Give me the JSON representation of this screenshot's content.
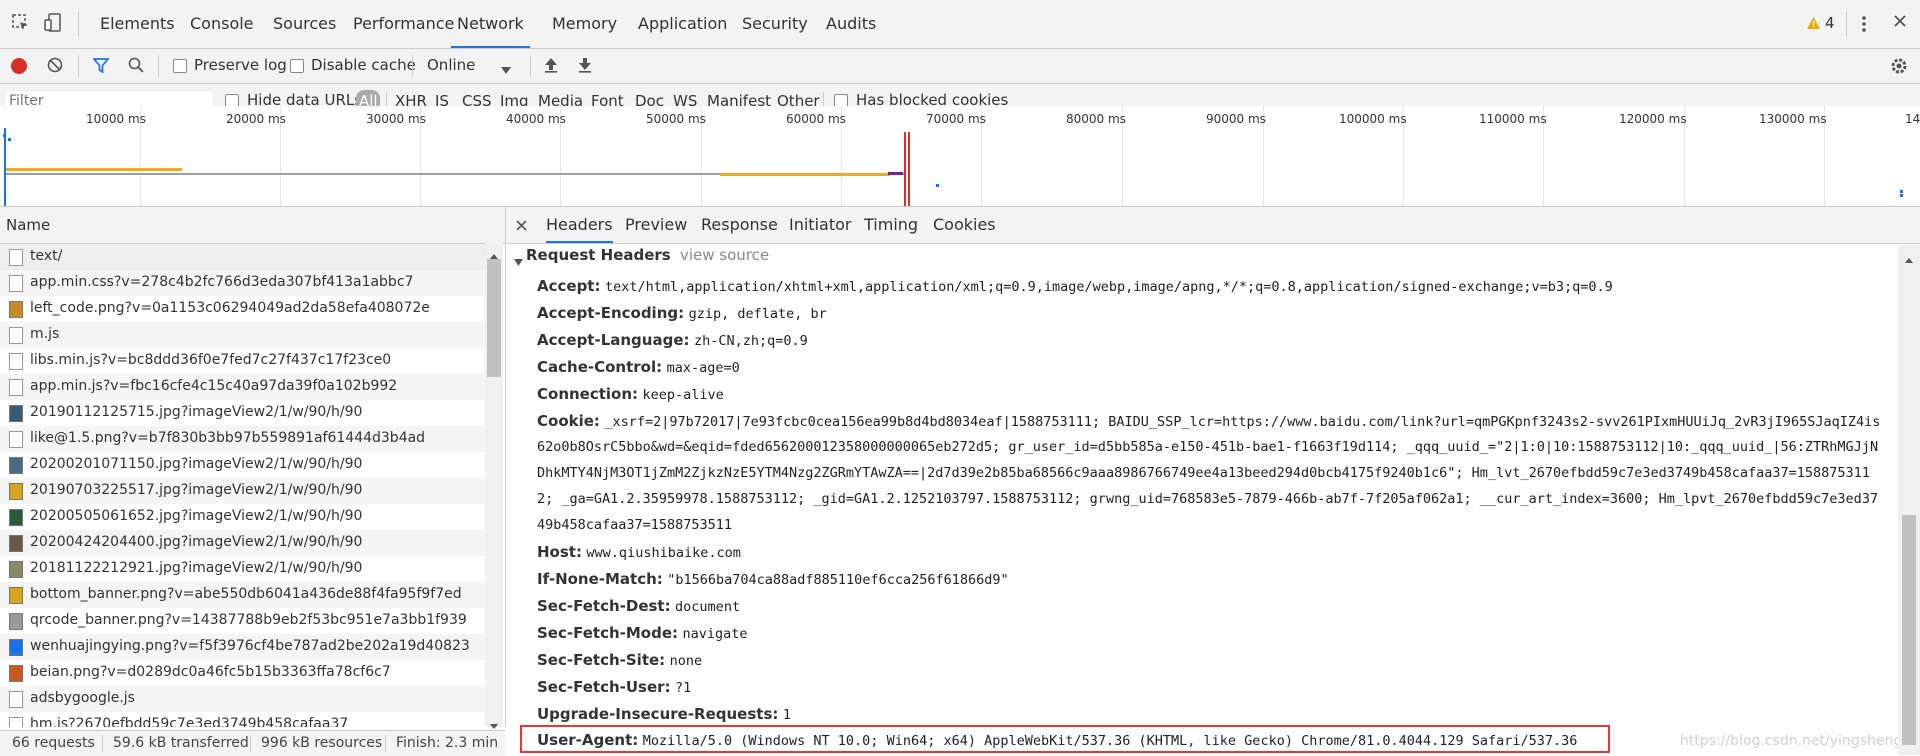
{
  "topbar": {
    "tabs": [
      "Elements",
      "Console",
      "Sources",
      "Performance",
      "Network",
      "Memory",
      "Application",
      "Security",
      "Audits"
    ],
    "active_tab": "Network",
    "warning_count": "4"
  },
  "toolbar": {
    "preserve_log": "Preserve log",
    "disable_cache": "Disable cache",
    "throttle": "Online"
  },
  "filterbar": {
    "placeholder": "Filter",
    "hide_data_urls": "Hide data URLs",
    "types": [
      "All",
      "XHR",
      "JS",
      "CSS",
      "Img",
      "Media",
      "Font",
      "Doc",
      "WS",
      "Manifest",
      "Other"
    ],
    "has_blocked_cookies": "Has blocked cookies"
  },
  "overview": {
    "ticks": [
      "10000 ms",
      "20000 ms",
      "30000 ms",
      "40000 ms",
      "50000 ms",
      "60000 ms",
      "70000 ms",
      "80000 ms",
      "90000 ms",
      "100000 ms",
      "110000 ms",
      "120000 ms",
      "130000 ms",
      "14"
    ]
  },
  "requests": {
    "header": "Name",
    "items": [
      "text/",
      "app.min.css?v=278c4b2fc766d3eda307bf413a1abbc7",
      "left_code.png?v=0a1153c06294049ad2da58efa408072e",
      "m.js",
      "libs.min.js?v=bc8ddd36f0e7fed7c27f437c17f23ce0",
      "app.min.js?v=fbc16cfe4c15c40a97da39f0a102b992",
      "20190112125715.jpg?imageView2/1/w/90/h/90",
      "like@1.5.png?v=b7f830b3bb97b559891af61444d3b4ad",
      "20200201071150.jpg?imageView2/1/w/90/h/90",
      "20190703225517.jpg?imageView2/1/w/90/h/90",
      "20200505061652.jpg?imageView2/1/w/90/h/90",
      "20200424204400.jpg?imageView2/1/w/90/h/90",
      "20181122212921.jpg?imageView2/1/w/90/h/90",
      "bottom_banner.png?v=abe550db6041a436de88f4fa95f9f7ed",
      "qrcode_banner.png?v=14387788b9eb2f53bc951e7a3bb1f939",
      "wenhuajingying.png?v=f5f3976cf4be787ad2be202a19d40823",
      "beian.png?v=d0289dc0a46fc5b15b3363ffa78cf6c7",
      "adsbygoogle.js",
      "hm.js?2670efbdd59c7e3ed3749b458cafaa37"
    ]
  },
  "status": {
    "requests": "66 requests",
    "transferred": "59.6 kB transferred",
    "resources": "996 kB resources",
    "finish": "Finish: 2.3 min"
  },
  "details": {
    "tabs": [
      "Headers",
      "Preview",
      "Response",
      "Initiator",
      "Timing",
      "Cookies"
    ],
    "active_tab": "Headers",
    "section_title": "Request Headers",
    "view_source": "view source",
    "headers": [
      {
        "key": "Accept:",
        "value": "text/html,application/xhtml+xml,application/xml;q=0.9,image/webp,image/apng,*/*;q=0.8,application/signed-exchange;v=b3;q=0.9"
      },
      {
        "key": "Accept-Encoding:",
        "value": "gzip, deflate, br"
      },
      {
        "key": "Accept-Language:",
        "value": "zh-CN,zh;q=0.9"
      },
      {
        "key": "Cache-Control:",
        "value": "max-age=0"
      },
      {
        "key": "Connection:",
        "value": "keep-alive"
      }
    ],
    "cookie_key": "Cookie:",
    "cookie_lines": [
      "_xsrf=2|97b72017|7e93fcbc0cea156ea99b8d4bd8034eaf|1588753111; BAIDU_SSP_lcr=https://www.baidu.com/link?url=qmPGKpnf3243s2-svv261PIxmHUUiJq_2vR3jI965SJaqIZ4is",
      "62o0b8OsrC5bbo&wd=&eqid=fded656200012358000000065eb272d5; gr_user_id=d5bb585a-e150-451b-bae1-f1663f19d114; _qqq_uuid_=\"2|1:0|10:1588753112|10:_qqq_uuid_|56:ZTRhMGJjN",
      "DhkMTY4NjM3OT1jZmM2ZjkzNzE5YTM4Nzg2ZGRmYTAwZA==|2d7d39e2b85ba68566c9aaa8986766749ee4a13beed294d0bcb4175f9240b1c6\"; Hm_lvt_2670efbdd59c7e3ed3749b458cafaa37=158875311",
      "2; _ga=GA1.2.35959978.1588753112; _gid=GA1.2.1252103797.1588753112; grwng_uid=768583e5-7879-466b-ab7f-7f205af062a1; __cur_art_index=3600; Hm_lpvt_2670efbdd59c7e3ed37",
      "49b458cafaa37=1588753511"
    ],
    "headers2": [
      {
        "key": "Host:",
        "value": "www.qiushibaike.com"
      },
      {
        "key": "If-None-Match:",
        "value": "\"b1566ba704ca88adf885110ef6cca256f61866d9\""
      },
      {
        "key": "Sec-Fetch-Dest:",
        "value": "document"
      },
      {
        "key": "Sec-Fetch-Mode:",
        "value": "navigate"
      },
      {
        "key": "Sec-Fetch-Site:",
        "value": "none"
      },
      {
        "key": "Sec-Fetch-User:",
        "value": "?1"
      },
      {
        "key": "Upgrade-Insecure-Requests:",
        "value": "1"
      }
    ],
    "user_agent_key": "User-Agent:",
    "user_agent_value": "Mozilla/5.0 (Windows NT 10.0; Win64; x64) AppleWebKit/537.36 (KHTML, like Gecko) Chrome/81.0.4044.129 Safari/537.36",
    "watermark": "https://blog.csdn.net/yingshengli"
  },
  "colors": {
    "accent": "#1a73e8",
    "record_red": "#d93025",
    "highlight_box": "#e53935",
    "timeline_orange": "#f5a623",
    "warning": "#f2a600"
  }
}
